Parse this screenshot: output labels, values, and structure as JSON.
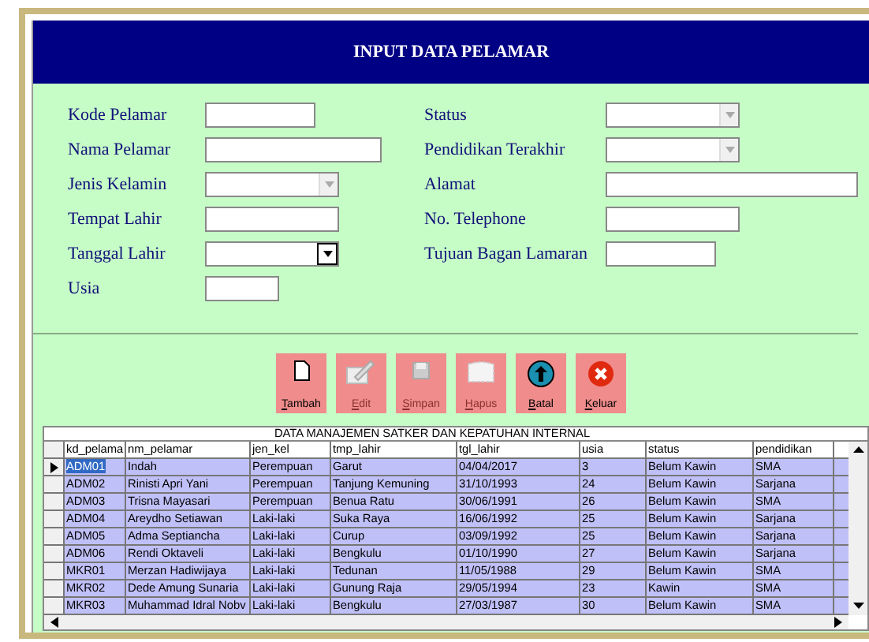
{
  "header": {
    "title": "INPUT DATA PELAMAR"
  },
  "form_left": [
    {
      "label": "Kode Pelamar",
      "kind": "text"
    },
    {
      "label": "Nama Pelamar",
      "kind": "text"
    },
    {
      "label": "Jenis Kelamin",
      "kind": "combo"
    },
    {
      "label": "Tempat Lahir",
      "kind": "text"
    },
    {
      "label": "Tanggal Lahir",
      "kind": "date"
    },
    {
      "label": "Usia",
      "kind": "text"
    }
  ],
  "form_right": [
    {
      "label": "Status",
      "kind": "combo"
    },
    {
      "label": "Pendidikan Terakhir",
      "kind": "combo"
    },
    {
      "label": "Alamat",
      "kind": "text"
    },
    {
      "label": "No.  Telephone",
      "kind": "text"
    },
    {
      "label": "Tujuan Bagan Lamaran",
      "kind": "text"
    }
  ],
  "buttons": [
    {
      "label": "Tambah",
      "disabled": false
    },
    {
      "label": "Edit",
      "disabled": true
    },
    {
      "label": "Simpan",
      "disabled": true
    },
    {
      "label": "Hapus",
      "disabled": true
    },
    {
      "label": "Batal",
      "disabled": false
    },
    {
      "label": "Keluar",
      "disabled": false
    }
  ],
  "table": {
    "title": "DATA MANAJEMEN SATKER DAN KEPATUHAN INTERNAL",
    "columns": [
      "kd_pelama",
      "nm_pelamar",
      "jen_kel",
      "tmp_lahir",
      "tgl_lahir",
      "usia",
      "status",
      "pendidikan"
    ],
    "rows": [
      {
        "selected": true,
        "cells": [
          "ADM01",
          "Indah",
          "Perempuan",
          "Garut",
          "04/04/2017",
          "3",
          "Belum Kawin",
          "SMA"
        ]
      },
      {
        "selected": false,
        "cells": [
          "ADM02",
          "Rinisti Apri Yani",
          "Perempuan",
          "Tanjung Kemuning",
          "31/10/1993",
          "24",
          "Belum Kawin",
          "Sarjana"
        ]
      },
      {
        "selected": false,
        "cells": [
          "ADM03",
          "Trisna Mayasari",
          "Perempuan",
          "Benua Ratu",
          "30/06/1991",
          "26",
          "Belum Kawin",
          "SMA"
        ]
      },
      {
        "selected": false,
        "cells": [
          "ADM04",
          "Areydho Setiawan",
          "Laki-laki",
          "Suka Raya",
          "16/06/1992",
          "25",
          "Belum Kawin",
          "Sarjana"
        ]
      },
      {
        "selected": false,
        "cells": [
          "ADM05",
          "Adma Septiancha",
          "Laki-laki",
          "Curup",
          "03/09/1992",
          "25",
          "Belum Kawin",
          "Sarjana"
        ]
      },
      {
        "selected": false,
        "cells": [
          "ADM06",
          "Rendi Oktaveli",
          "Laki-laki",
          "Bengkulu",
          "01/10/1990",
          "27",
          "Belum Kawin",
          "Sarjana"
        ]
      },
      {
        "selected": false,
        "cells": [
          "MKR01",
          "Merzan Hadiwijaya",
          "Laki-laki",
          "Tedunan",
          "11/05/1988",
          "29",
          "Belum Kawin",
          "SMA"
        ]
      },
      {
        "selected": false,
        "cells": [
          "MKR02",
          "Dede Amung Sunaria",
          "Laki-laki",
          "Gunung Raja",
          "29/05/1994",
          "23",
          "Kawin",
          "SMA"
        ]
      },
      {
        "selected": false,
        "cells": [
          "MKR03",
          "Muhammad Idral Nobv",
          "Laki-laki",
          "Bengkulu",
          "27/03/1987",
          "30",
          "Belum Kawin",
          "SMA"
        ]
      }
    ]
  }
}
